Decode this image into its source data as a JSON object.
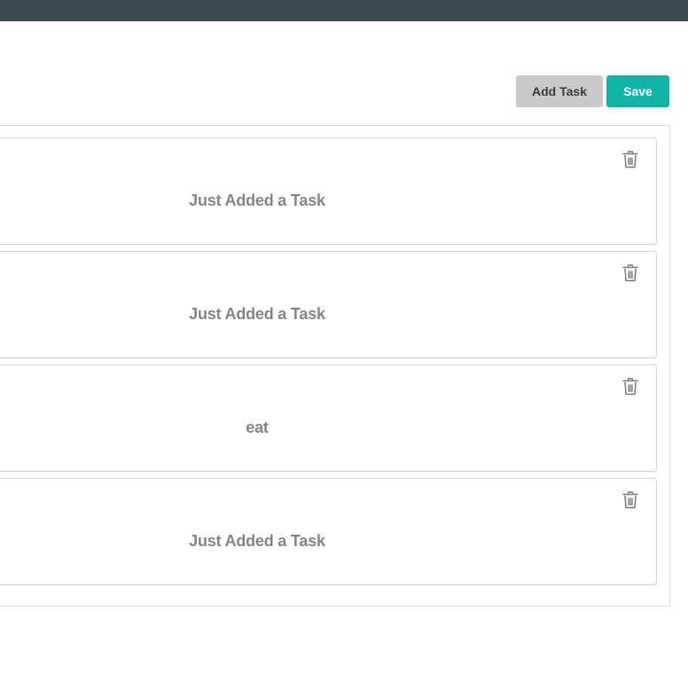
{
  "toolbar": {
    "add_task_label": "Add Task",
    "save_label": "Save"
  },
  "tasks": [
    {
      "title": "Just Added a Task",
      "delete_icon": "trash-icon"
    },
    {
      "title": "Just Added a Task",
      "delete_icon": "trash-icon"
    },
    {
      "title": "eat",
      "delete_icon": "trash-icon"
    },
    {
      "title": "Just Added a Task",
      "delete_icon": "trash-icon"
    }
  ],
  "colors": {
    "topbar": "#3a4a52",
    "save_button": "#10b4a6",
    "add_button": "#c9cacb",
    "task_text": "#858585"
  }
}
